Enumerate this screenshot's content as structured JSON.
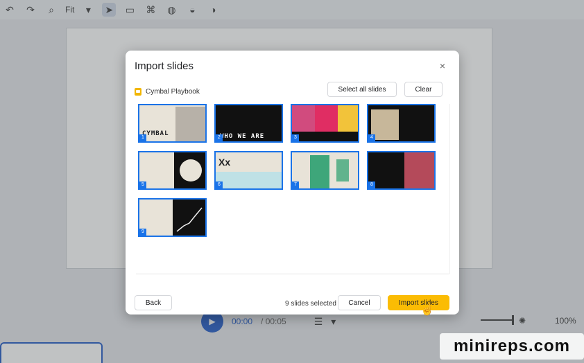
{
  "toolbar": {
    "fit_label": "Fit",
    "icons": [
      "undo-icon",
      "redo-icon",
      "zoom-icon",
      "select-icon",
      "comment-icon",
      "paint-format-icon",
      "palette-icon",
      "fill-icon",
      "theme-icon"
    ]
  },
  "player": {
    "current_time": "00:00",
    "total_time": "/ 00:05",
    "zoom": "100%"
  },
  "dialog": {
    "title": "Import slides",
    "close": "×",
    "source_name": "Cymbal Playbook",
    "select_all_label": "Select all slides",
    "clear_label": "Clear",
    "back_label": "Back",
    "selected_count": "9 slides selected",
    "cancel_label": "Cancel",
    "import_label": "Import slides",
    "slides": [
      {
        "num": "1",
        "title": "CYMBAL",
        "bg": "#e8e3d8"
      },
      {
        "num": "2",
        "title": "WHO WE ARE",
        "bg": "#111111"
      },
      {
        "num": "3",
        "title": "",
        "bg": "#111111"
      },
      {
        "num": "4",
        "title": "",
        "bg": "#111111"
      },
      {
        "num": "5",
        "title": "",
        "bg": "#e8e3d8"
      },
      {
        "num": "6",
        "title": "Xx",
        "bg": "#e8e3d8"
      },
      {
        "num": "7",
        "title": "",
        "bg": "#e8e3d8"
      },
      {
        "num": "8",
        "title": "",
        "bg": "#111111"
      },
      {
        "num": "9",
        "title": "",
        "bg": "#e8e3d8"
      }
    ]
  },
  "watermark": "minireps.com",
  "colors": {
    "accent": "#1a73e8",
    "import_button": "#fbbc04"
  }
}
